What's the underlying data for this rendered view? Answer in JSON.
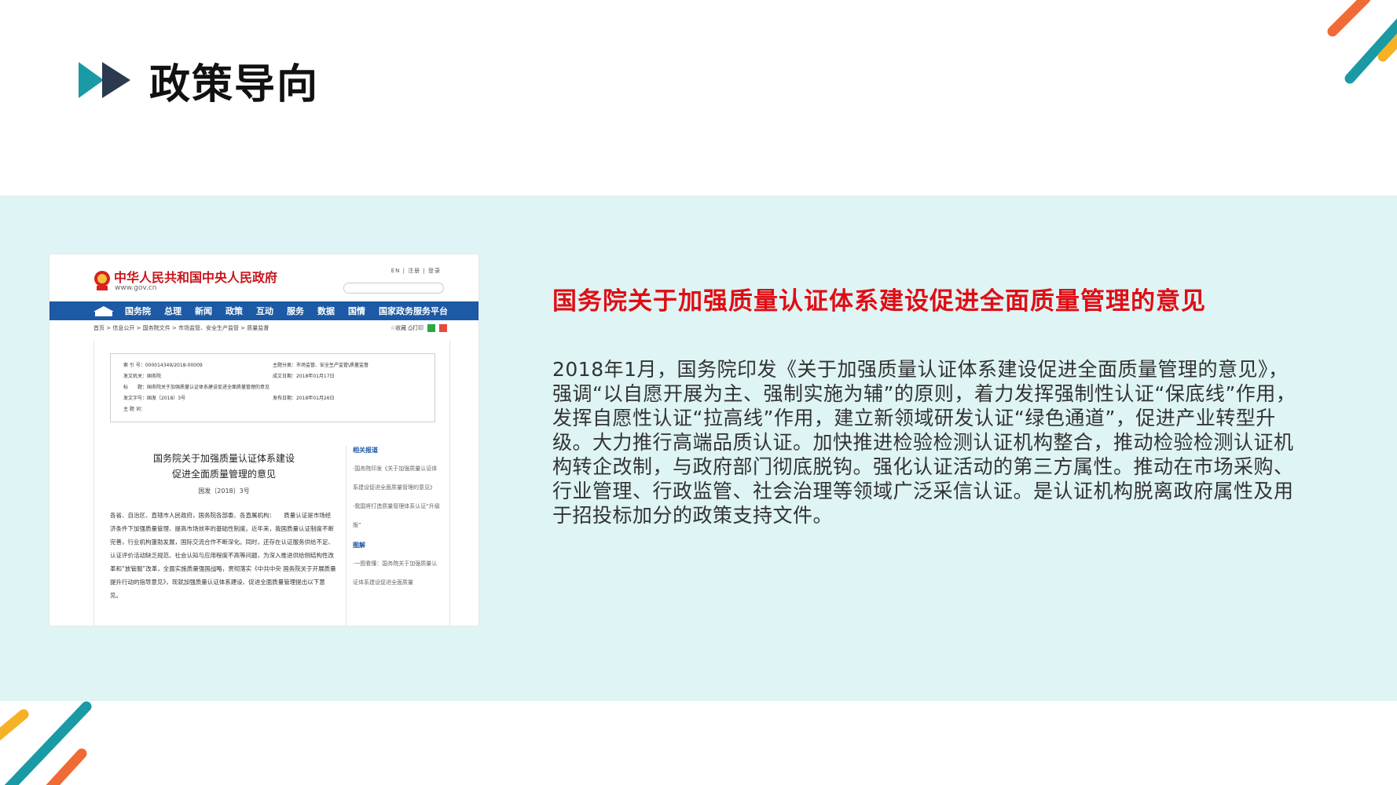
{
  "header": {
    "title": "政策导向"
  },
  "screenshot": {
    "site_name": "中华人民共和国中央人民政府",
    "site_url": "www.gov.cn",
    "top_links": "EN | 注册 | 登录",
    "nav": [
      "国务院",
      "总理",
      "新闻",
      "政策",
      "互动",
      "服务",
      "数据",
      "国情",
      "国家政务服务平台"
    ],
    "breadcrumb": "首页 > 信息公开 > 国务院文件 > 市场监管、安全生产监管 > 质量监督",
    "tools": "☆收藏  ⎙打印",
    "meta": {
      "index_no": "索 引 号：000014349/2018-00009",
      "category": "主题分类：市场监管、安全生产监管\\质量监督",
      "issuer": "发文机关：国务院",
      "written_date": "成文日期：2018年01月17日",
      "title": "标　　题：国务院关于加强质量认证体系建设促进全面质量管理的意见",
      "doc_no": "发文字号：国发〔2018〕3号",
      "publish_date": "发布日期：2018年01月26日",
      "keywords": "主 题 词："
    },
    "doc_title_line1": "国务院关于加强质量认证体系建设",
    "doc_title_line2": "促进全面质量管理的意见",
    "doc_no": "国发〔2018〕3号",
    "doc_body": "各省、自治区、直辖市人民政府，国务院各部委、各直属机构：　　质量认证是市场经济条件下加强质量管理、提高市场效率的基础性制度。近年来，我国质量认证制度不断完善，行业机构蓬勃发展，国际交流合作不断深化。同时，还存在认证服务供给不足、认证评价活动缺乏规范、社会认知与应用程度不高等问题，为深入推进供给侧结构性改革和“放管服”改革，全面实施质量强国战略，贯彻落实《中共中央 国务院关于开展质量提升行动的指导意见》，现就加强质量认证体系建设、促进全面质量管理提出以下意见。",
    "side_heading1": "相关报道",
    "side_items1": [
      "·国务院印发《关于加强质量认证体系建设促进全面质量管理的意见》",
      "·我国将打造质量管理体系认证“升级版”"
    ],
    "side_heading2": "图解",
    "side_items2": [
      "·一图看懂：国务院关于加强质量认证体系建设促进全面质量"
    ]
  },
  "main": {
    "heading": "国务院关于加强质量认证体系建设促进全面质量管理的意见",
    "body": "2018年1月，国务院印发《关于加强质量认证体系建设促进全面质量管理的意见》，强调“以自愿开展为主、强制实施为辅”的原则，着力发挥强制性认证“保底线”作用，发挥自愿性认证“拉高线”作用，建立新领域研发认证“绿色通道”，促进产业转型升级。大力推行高端品质认证。加快推进检验检测认证机构整合，推动检验检测认证机构转企改制，与政府部门彻底脱钩。强化认证活动的第三方属性。推动在市场采购、行业管理、行政监管、社会治理等领域广泛采信认证。是认证机构脱离政府属性及用于招投标加分的政策支持文件。"
  },
  "colors": {
    "band": "#dff4f4",
    "heading_red": "#e00d14",
    "teal": "#1a9aa5",
    "navy": "#2b3a4f",
    "orange": "#f06a35",
    "yellow": "#f5b227",
    "gov_blue": "#1c5aa6",
    "gov_red": "#c8161d"
  }
}
